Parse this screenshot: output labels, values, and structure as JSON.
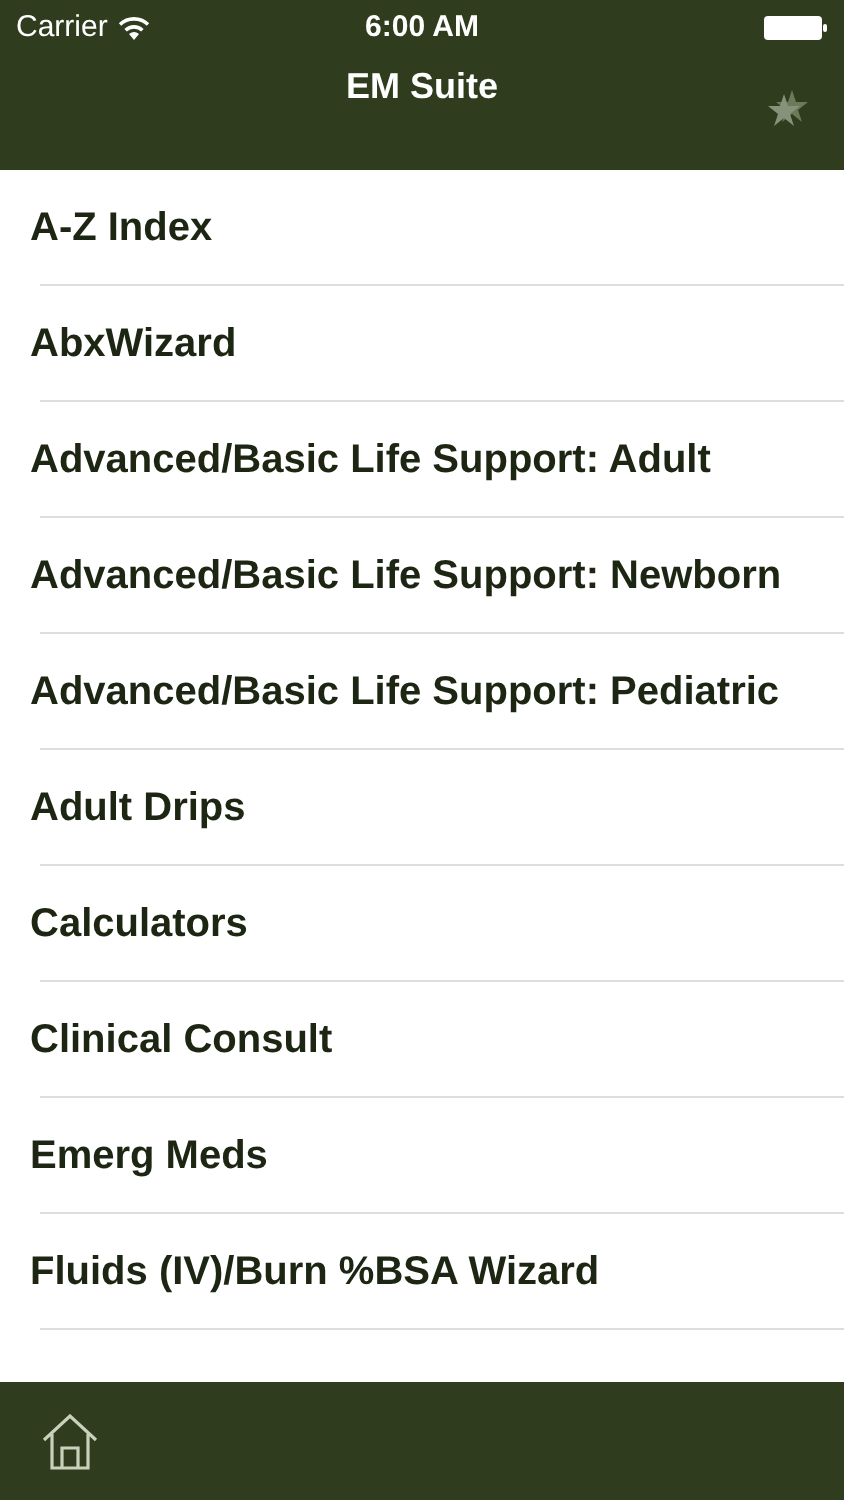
{
  "status_bar": {
    "carrier": "Carrier",
    "time": "6:00 AM"
  },
  "nav_bar": {
    "title": "EM Suite"
  },
  "menu_items": [
    {
      "label": "A-Z Index"
    },
    {
      "label": "AbxWizard"
    },
    {
      "label": "Advanced/Basic Life Support: Adult"
    },
    {
      "label": "Advanced/Basic Life Support: Newborn"
    },
    {
      "label": "Advanced/Basic Life Support: Pediatric"
    },
    {
      "label": "Adult Drips"
    },
    {
      "label": "Calculators"
    },
    {
      "label": "Clinical Consult"
    },
    {
      "label": "Emerg Meds"
    },
    {
      "label": "Fluids (IV)/Burn %BSA Wizard"
    }
  ]
}
